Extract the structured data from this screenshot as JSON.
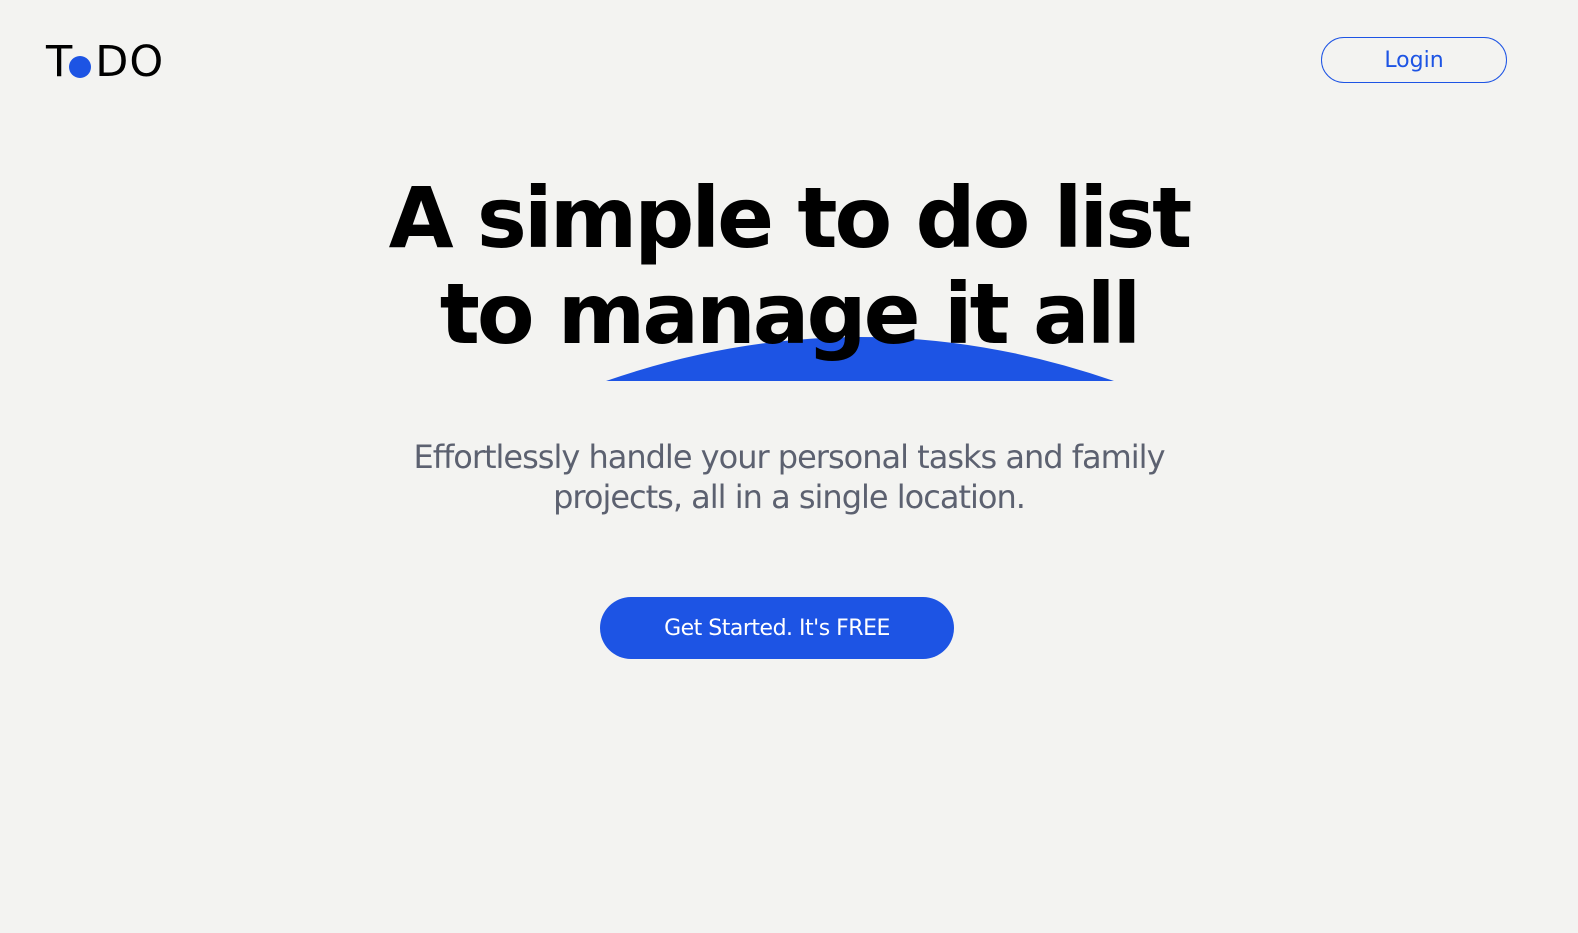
{
  "brand": {
    "logo_first": "T",
    "logo_rest": "DO",
    "accent_color": "#1d54e4"
  },
  "header": {
    "login_label": "Login"
  },
  "hero": {
    "title_line1": "A simple to do list",
    "title_line2": "to manage it all",
    "subtitle_line1": "Effortlessly handle your personal tasks and family",
    "subtitle_line2": "projects, all in a single location.",
    "cta_label": "Get Started. It's FREE"
  },
  "icons": {
    "logo_dot": "filled-circle",
    "title_underline": "blue-arc-swoosh"
  }
}
